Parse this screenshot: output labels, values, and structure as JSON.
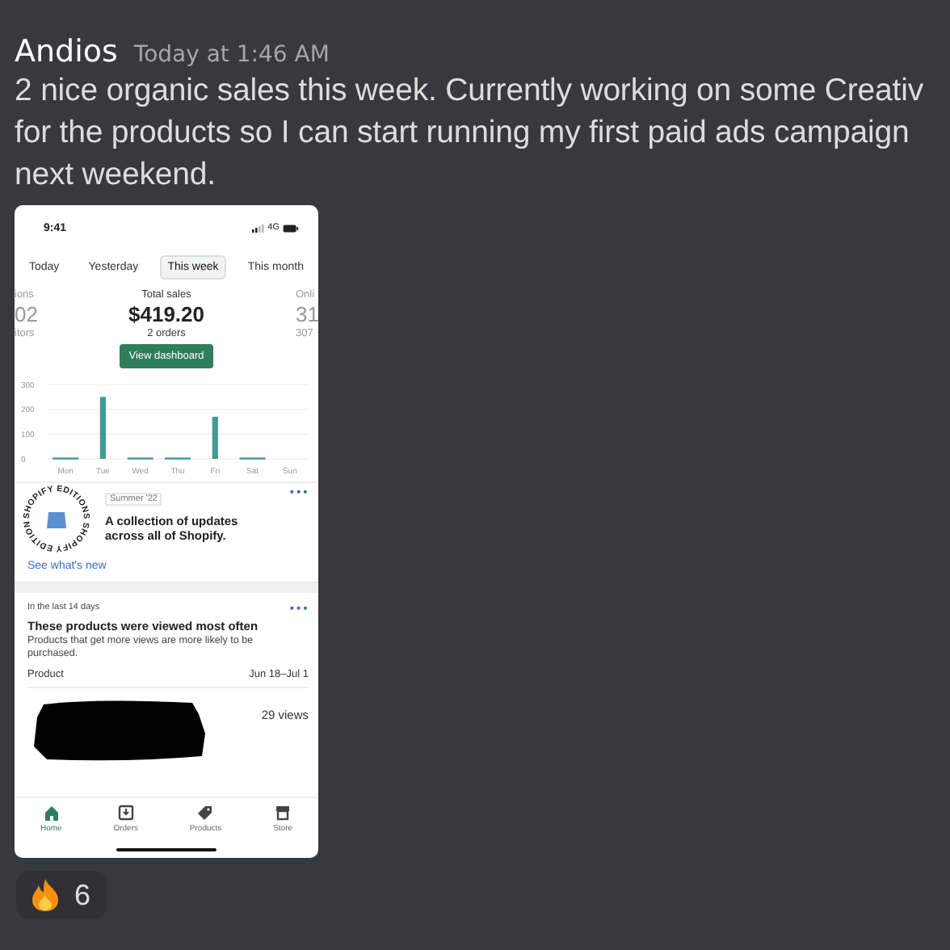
{
  "message": {
    "author": "Andios",
    "timestamp": "Today at 1:46 AM",
    "lines": [
      "2 nice organic sales this week. Currently working on some Creativ",
      "for the products so I can start running my first paid ads campaign",
      "next weekend."
    ]
  },
  "attachment": {
    "status_bar": {
      "time": "9:41",
      "network": "4G"
    },
    "tabs": [
      {
        "label": "Today",
        "selected": false
      },
      {
        "label": "Yesterday",
        "selected": false
      },
      {
        "label": "This week",
        "selected": true
      },
      {
        "label": "This month",
        "selected": false
      }
    ],
    "stats": [
      {
        "label": "ions",
        "value": "02",
        "sub": "itors"
      },
      {
        "label": "Total sales",
        "value": "$419.20",
        "sub": "2 orders"
      },
      {
        "label": "Onli",
        "value": "31",
        "sub": "307"
      }
    ],
    "dashboard_button": "View dashboard",
    "chart_data": {
      "type": "bar",
      "categories": [
        "Mon",
        "Tue",
        "Wed",
        "Thu",
        "Fri",
        "Sat",
        "Sun"
      ],
      "values": [
        0,
        250,
        0,
        0,
        170,
        0,
        null
      ],
      "ylim": [
        0,
        300
      ],
      "yticks": [
        0,
        100,
        200,
        300
      ]
    },
    "editions_card": {
      "badge_text": "SHOPIFY EDITIONS SHOPIFY EDITIONS",
      "tag": "Summer '22",
      "title": "A collection of updates across all of Shopify.",
      "link": "See what's new",
      "menu": "•••"
    },
    "products_card": {
      "eyebrow": "In the last 14 days",
      "title": "These products were viewed most often",
      "description": "Products that get more views are more likely to be purchased.",
      "menu": "•••",
      "column_1": "Product",
      "column_2": "Jun 18–Jul 1",
      "rows": [
        {
          "views": "29 views"
        }
      ]
    },
    "nav": [
      {
        "label": "Home",
        "selected": true
      },
      {
        "label": "Orders",
        "selected": false
      },
      {
        "label": "Products",
        "selected": false
      },
      {
        "label": "Store",
        "selected": false
      }
    ]
  },
  "reactions": [
    {
      "count": "6"
    }
  ]
}
